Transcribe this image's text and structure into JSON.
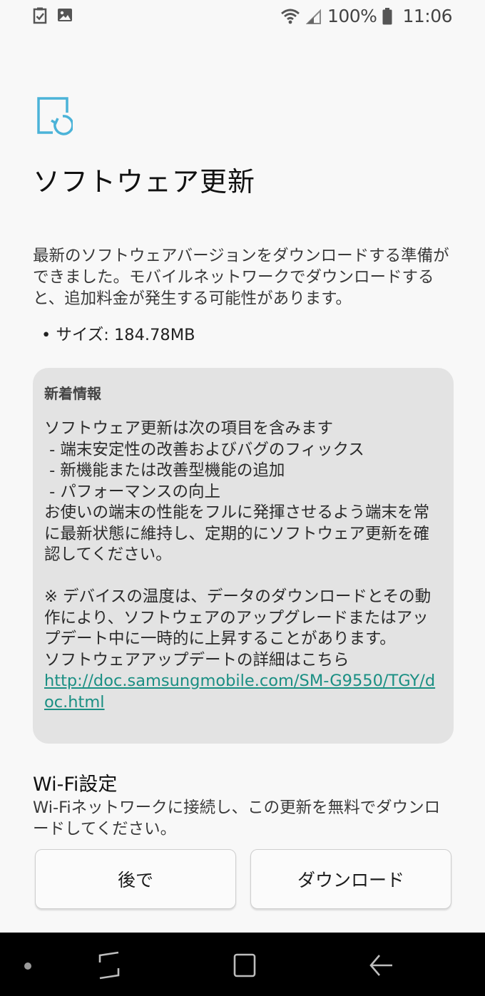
{
  "status_bar": {
    "battery": "100%",
    "time": "11:06",
    "icons": [
      "task-checkbox-icon",
      "gallery-icon",
      "wifi-icon",
      "cell-signal-icon",
      "battery-icon"
    ]
  },
  "header": {
    "icon": "software-update-icon",
    "title": "ソフトウェア更新"
  },
  "description": "最新のソフトウェアバージョンをダウンロードする準備ができました。モバイルネットワークでダウンロードすると、追加料金が発生する可能性があります。",
  "size_line": "• サイズ: 184.78MB",
  "whats_new": {
    "title": "新着情報",
    "body": "ソフトウェア更新は次の項目を含みます\n - 端末安定性の改善およびバグのフィックス\n - 新機能または改善型機能の追加\n - パフォーマンスの向上\nお使いの端末の性能をフルに発揮させるよう端末を常に最新状態に維持し、定期的にソフトウェア更新を確認してください。\n\n※ デバイスの温度は、データのダウンロードとその動作により、ソフトウェアのアップグレードまたはアップデート中に一時的に上昇することがあります。\nソフトウェアアップデートの詳細はこちら",
    "link": "http://doc.samsungmobile.com/SM-G9550/TGY/doc.html"
  },
  "wifi_settings": {
    "title": "Wi-Fi設定",
    "description": "Wi-Fiネットワークに接続し、この更新を無料でダウンロードしてください。"
  },
  "buttons": {
    "later": "後で",
    "download": "ダウンロード"
  },
  "navigation": [
    "recent-apps-icon",
    "home-icon",
    "back-icon"
  ],
  "colors": {
    "accent": "#4bb3d8",
    "link": "#1a8f83",
    "card_bg": "#e3e3e3",
    "nav_bg": "#000000"
  }
}
